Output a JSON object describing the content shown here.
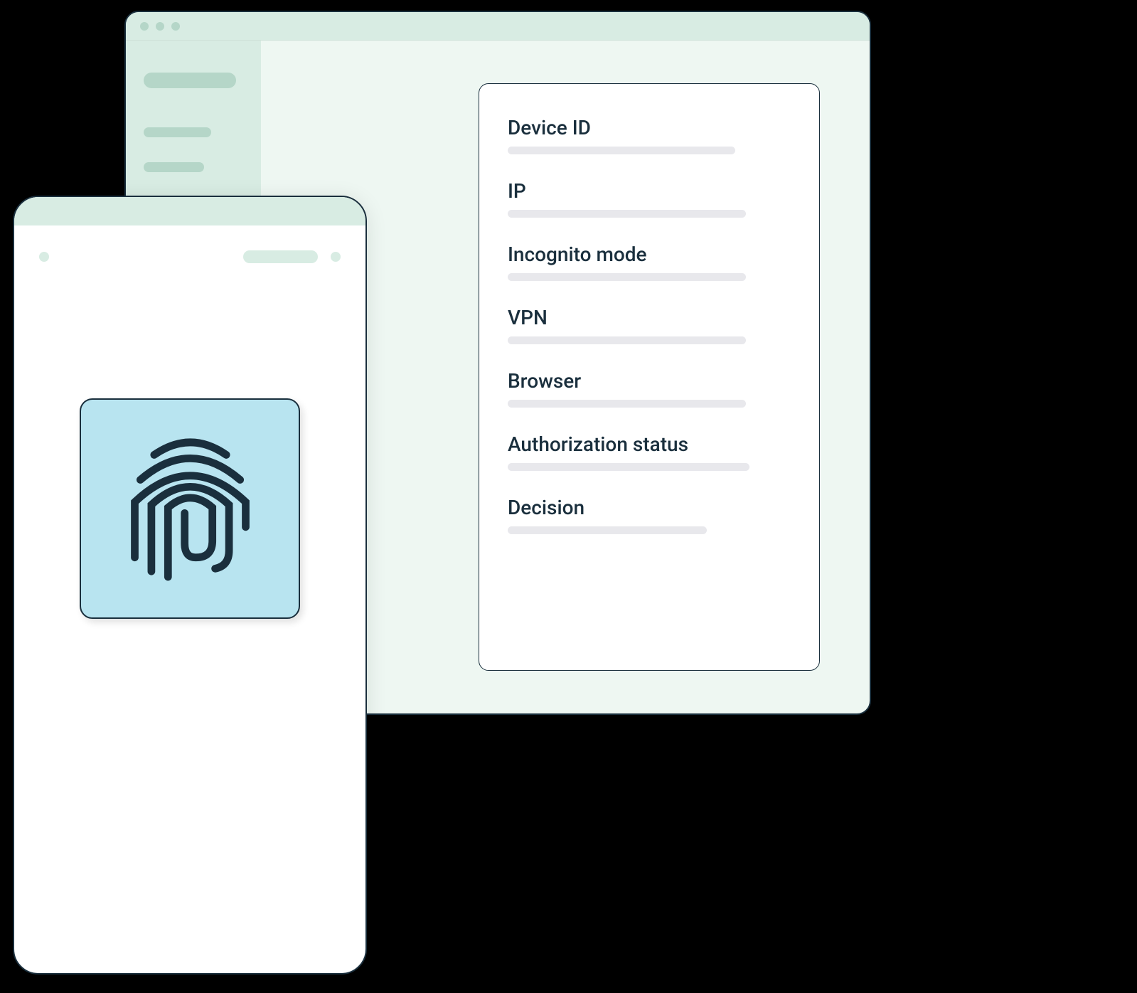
{
  "browser": {
    "info_labels": [
      "Device ID",
      "IP",
      "Incognito mode",
      "VPN",
      "Browser",
      "Authorization status",
      "Decision"
    ]
  },
  "mobile": {
    "fingerprint_icon": "fingerprint"
  },
  "colors": {
    "border_dark": "#1a2f3d",
    "mint_light": "#eef7f2",
    "mint_mid": "#d8ece3",
    "mint_dark": "#b5d6c8",
    "fingerprint_bg": "#b8e4f0",
    "placeholder_gray": "#e8e8ec"
  }
}
